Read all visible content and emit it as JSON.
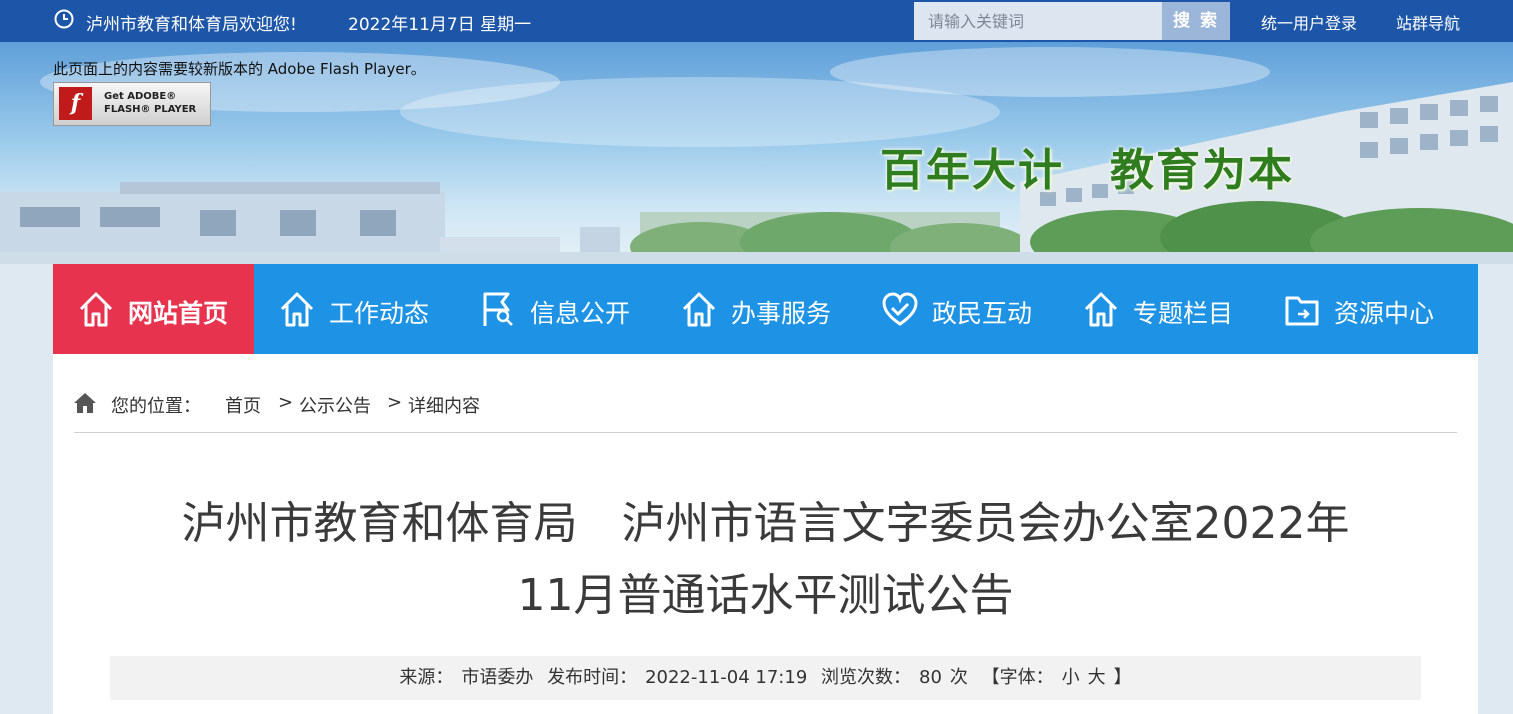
{
  "topbar": {
    "welcome": "泸州市教育和体育局欢迎您!",
    "date": "2022年11月7日 星期一",
    "search_placeholder": "请输入关键词",
    "search_button": "搜 索",
    "login": "统一用户登录",
    "site_nav": "站群导航"
  },
  "banner": {
    "flash_note": "此页面上的内容需要较新版本的 Adobe Flash Player。",
    "flash_button_line1": "Get ADOBE®",
    "flash_button_line2": "FLASH® PLAYER",
    "slogan": "百年大计　教育为本"
  },
  "nav": [
    {
      "label": "网站首页",
      "icon": "home-icon",
      "active": true
    },
    {
      "label": "工作动态",
      "icon": "home-icon",
      "active": false
    },
    {
      "label": "信息公开",
      "icon": "flag-search-icon",
      "active": false
    },
    {
      "label": "办事服务",
      "icon": "home-icon",
      "active": false
    },
    {
      "label": "政民互动",
      "icon": "heart-icon",
      "active": false
    },
    {
      "label": "专题栏目",
      "icon": "home-icon",
      "active": false
    },
    {
      "label": "资源中心",
      "icon": "folder-icon",
      "active": false
    }
  ],
  "breadcrumb": {
    "prefix": "您的位置：",
    "home": "首页",
    "sep": ">",
    "section": "公示公告",
    "current": "详细内容"
  },
  "article": {
    "title_line1": "泸州市教育和体育局　泸州市语言文字委员会办公室2022年",
    "title_line2": "11月普通话水平测试公告",
    "source_label": "来源：",
    "source": "市语委办",
    "published_label": "发布时间：",
    "published": "2022-11-04 17:19",
    "views_label": "浏览次数：",
    "views": "80",
    "views_unit": "次",
    "font_label": "【字体：",
    "font_small": "小",
    "font_large": "大",
    "font_close": "】"
  },
  "colors": {
    "topbar": "#1d56a8",
    "nav": "#1e93e6",
    "nav_active": "#e8334f",
    "slogan": "#2f7d1e"
  }
}
